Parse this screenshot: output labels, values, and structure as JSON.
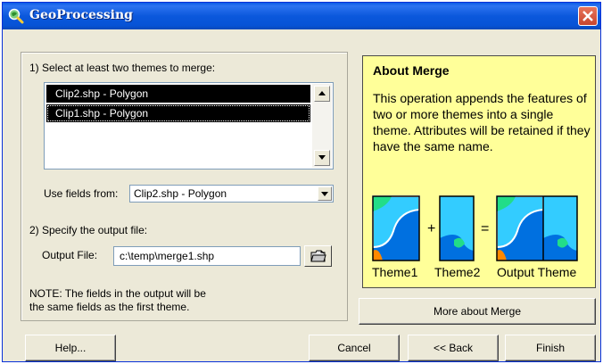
{
  "window": {
    "title": "GeoProcessing"
  },
  "step1": {
    "label": "1) Select at least two themes to merge:",
    "themes": [
      "Clip2.shp - Polygon",
      "Clip1.shp - Polygon"
    ]
  },
  "use_fields": {
    "label": "Use fields from:",
    "selected": "Clip2.shp - Polygon"
  },
  "step2": {
    "label": "2) Specify the output file:",
    "output_label": "Output File:",
    "output_value": "c:\\temp\\merge1.shp"
  },
  "note": {
    "line1": "NOTE: The fields in the output will be",
    "line2": "the same fields as the first theme."
  },
  "about": {
    "title": "About Merge",
    "description": "This operation appends the features of two or more themes into a single theme.  Attributes will be retained if they have the same name.",
    "plus": "+",
    "equals": "=",
    "captions": [
      "Theme1",
      "Theme2",
      "Output Theme"
    ],
    "colors": {
      "panel": "#ffff99",
      "cyan": "#33ccff",
      "green": "#22dd88",
      "blue": "#0070e0",
      "orange": "#ff8800"
    }
  },
  "buttons": {
    "more": "More about Merge",
    "help": "Help...",
    "cancel": "Cancel",
    "back": "<< Back",
    "finish": "Finish"
  }
}
